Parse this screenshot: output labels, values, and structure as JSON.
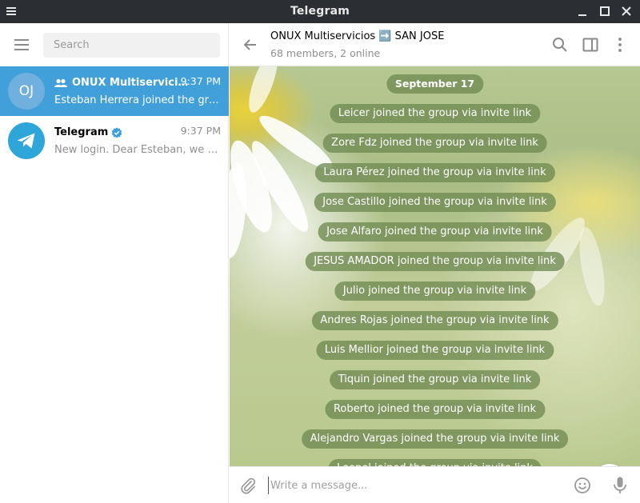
{
  "window": {
    "title": "Telegram"
  },
  "sidebar": {
    "search_placeholder": "Search",
    "chats": [
      {
        "initials": "OJ",
        "name": "ONUX Multiservicios ➡️ SAN JOSE",
        "time": "9:37 PM",
        "preview": "Esteban Herrera joined the group via invite link",
        "active": true,
        "icon": "group-icon"
      },
      {
        "name": "Telegram",
        "time": "9:37 PM",
        "preview": "New login. Dear Esteban, we detected a login into your account",
        "active": false,
        "icon": "verified-icon"
      }
    ]
  },
  "chat": {
    "title": "ONUX Multiservicios ➡️ SAN JOSE",
    "subtitle": "68 members, 2 online",
    "date_label": "September 17",
    "service_messages": [
      "Leicer joined the group via invite link",
      "Zore Fdz joined the group via invite link",
      "Laura Pérez joined the group via invite link",
      "Jose Castillo joined the group via invite link",
      "Jose Alfaro joined the group via invite link",
      "JESUS AMADOR joined the group via invite link",
      "Julio joined the group via invite link",
      "Andres Rojas joined the group via invite link",
      "Luis Mellior joined the group via invite link",
      "Tiquin joined the group via invite link",
      "Roberto joined the group via invite link",
      "Alejandro Vargas joined the group via invite link",
      "Leonel joined the group via invite link"
    ],
    "composer_placeholder": "Write a message..."
  },
  "colors": {
    "accent": "#419fd9",
    "titlebar": "#2b2f33",
    "service_pill": "#708a52"
  }
}
